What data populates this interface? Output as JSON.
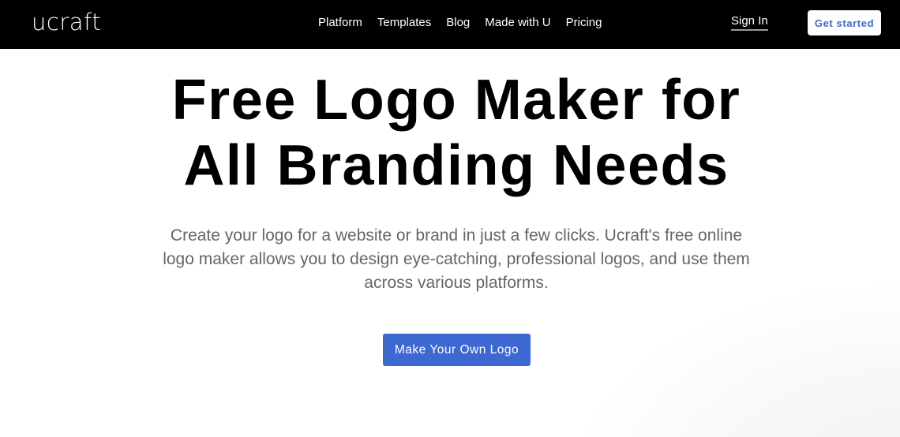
{
  "navbar": {
    "logo": "ucraft",
    "links": [
      {
        "label": "Platform"
      },
      {
        "label": "Templates"
      },
      {
        "label": "Blog"
      },
      {
        "label": "Made with U"
      },
      {
        "label": "Pricing"
      }
    ],
    "sign_in": "Sign In",
    "get_started": "Get started"
  },
  "hero": {
    "title_line1": "Free Logo Maker for",
    "title_line2": "All Branding Needs",
    "subtitle": "Create your logo for a website or brand in just a few clicks. Ucraft's free online logo maker allows you to design eye-catching, professional logos, and use them across various platforms.",
    "cta_label": "Make Your Own Logo"
  },
  "colors": {
    "navbar_bg": "#000000",
    "accent": "#3d67d1",
    "subtitle_text": "#666666"
  }
}
